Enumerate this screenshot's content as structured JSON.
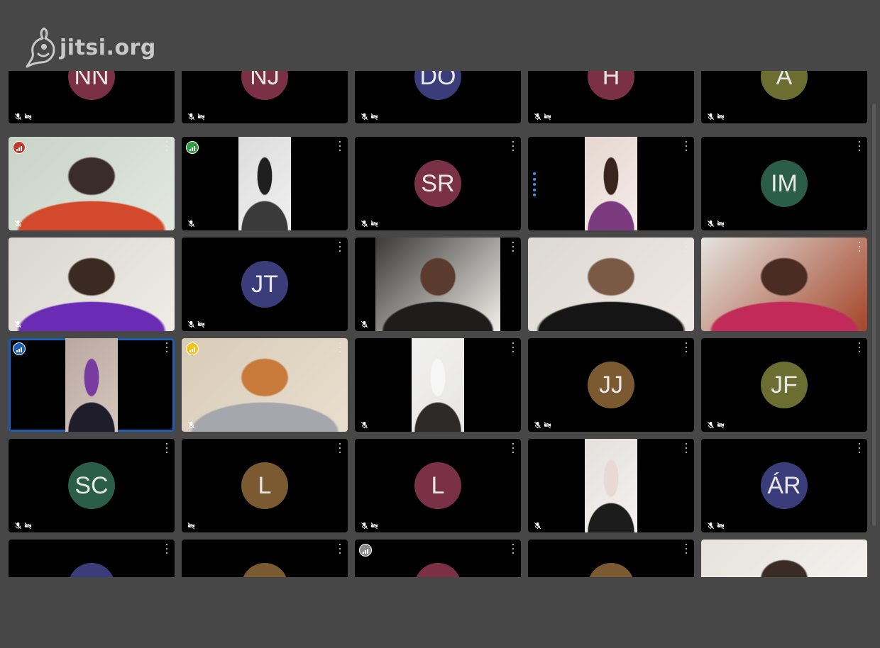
{
  "app": {
    "brand": "jitsi.org"
  },
  "tiles": [
    {
      "kind": "avatar",
      "initials": "NN",
      "color": "#7a3147",
      "mic_off": true,
      "cam_off": true,
      "menu": false
    },
    {
      "kind": "avatar",
      "initials": "NJ",
      "color": "#7a3147",
      "mic_off": true,
      "cam_off": true,
      "menu": false
    },
    {
      "kind": "avatar",
      "initials": "DO",
      "color": "#3b3d7a",
      "mic_off": true,
      "cam_off": true,
      "menu": false
    },
    {
      "kind": "avatar",
      "initials": "H",
      "color": "#7a3147",
      "mic_off": true,
      "cam_off": true,
      "menu": false
    },
    {
      "kind": "avatar",
      "initials": "A",
      "color": "#6b6e30",
      "mic_off": true,
      "cam_off": true,
      "menu": false
    },
    {
      "kind": "video",
      "width": "full",
      "scene": [
        "#c9d3c7",
        "#e2e8e0",
        "#d24a2b",
        "#3a2c2a"
      ],
      "quality": "#c0392b",
      "mic_off": true,
      "cam_off": false,
      "menu": true
    },
    {
      "kind": "video",
      "width": "narrow",
      "scene": [
        "#dcdcdc",
        "#f0f0f0",
        "#3a3a3a",
        "#1f1f1f"
      ],
      "quality": "#2e9e3f",
      "mic_off": true,
      "cam_off": false,
      "menu": true
    },
    {
      "kind": "avatar",
      "initials": "SR",
      "color": "#7a3147",
      "mic_off": true,
      "cam_off": true,
      "menu": true
    },
    {
      "kind": "video",
      "width": "narrow",
      "scene": [
        "#e6d7d0",
        "#f4ece8",
        "#7b3a7e",
        "#3a2420"
      ],
      "speaking": true,
      "mic_off": false,
      "cam_off": false,
      "menu": true
    },
    {
      "kind": "avatar",
      "initials": "IM",
      "color": "#2b5e4a",
      "mic_off": true,
      "cam_off": true,
      "menu": true
    },
    {
      "kind": "video",
      "width": "full",
      "scene": [
        "#d9d6d0",
        "#efece6",
        "#6a2bb5",
        "#3b2a22"
      ],
      "mic_off": true,
      "cam_off": false,
      "menu": true
    },
    {
      "kind": "avatar",
      "initials": "JT",
      "color": "#3b3d7a",
      "mic_off": true,
      "cam_off": true,
      "menu": true
    },
    {
      "kind": "video",
      "width": "wide",
      "scene": [
        "#3c3a38",
        "#f1efe9",
        "#1f1d1c",
        "#5a3b2e"
      ],
      "mic_off": true,
      "cam_off": false,
      "menu": true
    },
    {
      "kind": "video",
      "width": "full",
      "scene": [
        "#dcd8d2",
        "#efe9e4",
        "#151515",
        "#7a5a44"
      ],
      "mic_off": false,
      "cam_off": false,
      "menu": true
    },
    {
      "kind": "video",
      "width": "full",
      "scene": [
        "#e4e3de",
        "#a4452a",
        "#c22a5a",
        "#4a2c24"
      ],
      "mic_off": false,
      "cam_off": false,
      "menu": true
    },
    {
      "kind": "video",
      "width": "narrow",
      "scene": [
        "#b9a9a0",
        "#d6c7bf",
        "#1f1d2a",
        "#7a3ba0"
      ],
      "quality": "#1a5fb4",
      "active": true,
      "mic_off": false,
      "cam_off": false,
      "menu": true
    },
    {
      "kind": "video",
      "width": "full",
      "scene": [
        "#d8cbb8",
        "#e9dfce",
        "#a6a7ad",
        "#c87a3a"
      ],
      "quality": "#f0c419",
      "mic_off": true,
      "cam_off": false,
      "menu": true
    },
    {
      "kind": "video",
      "width": "narrow",
      "scene": [
        "#f0f0ef",
        "#e7e6e3",
        "#2d2a28",
        "#f6f6f6"
      ],
      "mic_off": true,
      "cam_off": false,
      "menu": true
    },
    {
      "kind": "avatar",
      "initials": "JJ",
      "color": "#7b5a32",
      "mic_off": true,
      "cam_off": true,
      "menu": true
    },
    {
      "kind": "avatar",
      "initials": "JF",
      "color": "#6b6e30",
      "mic_off": true,
      "cam_off": true,
      "menu": true
    },
    {
      "kind": "avatar",
      "initials": "SC",
      "color": "#2b5e4a",
      "mic_off": true,
      "cam_off": true,
      "menu": true
    },
    {
      "kind": "avatar",
      "initials": "L",
      "color": "#7b5a32",
      "mic_off": false,
      "cam_off": true,
      "menu": true
    },
    {
      "kind": "avatar",
      "initials": "L",
      "color": "#7a3147",
      "mic_off": true,
      "cam_off": true,
      "menu": true
    },
    {
      "kind": "video",
      "width": "narrow",
      "scene": [
        "#e3e1dc",
        "#f3f2ee",
        "#1c1c1c",
        "#e9d9d6"
      ],
      "mic_off": true,
      "cam_off": false,
      "menu": true
    },
    {
      "kind": "avatar",
      "initials": "ÁR",
      "color": "#3b3d7a",
      "mic_off": true,
      "cam_off": true,
      "menu": true
    },
    {
      "kind": "avatar",
      "initials": "",
      "color": "#3b3d7a",
      "mic_off": false,
      "cam_off": false,
      "menu": true
    },
    {
      "kind": "avatar",
      "initials": "",
      "color": "#7b5a32",
      "mic_off": false,
      "cam_off": false,
      "menu": true
    },
    {
      "kind": "avatar",
      "initials": "",
      "color": "#7a3147",
      "quality": "#8a8a8a",
      "mic_off": false,
      "cam_off": false,
      "menu": true
    },
    {
      "kind": "avatar",
      "initials": "",
      "color": "#7b5a32",
      "mic_off": false,
      "cam_off": false,
      "menu": true
    },
    {
      "kind": "video",
      "width": "full",
      "scene": [
        "#e6e3dc",
        "#f6f5f2",
        "#c78e74",
        "#3a2c25"
      ],
      "mic_off": false,
      "cam_off": false,
      "menu": false
    }
  ]
}
